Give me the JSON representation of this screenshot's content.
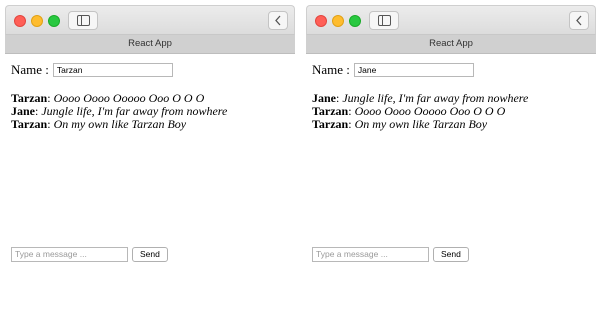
{
  "colors": {
    "close": "#ff5f57",
    "minimize": "#febc2e",
    "zoom": "#28c840",
    "tab_bar": "#d0d0d0"
  },
  "icons": {
    "sidebar": "sidebar-icon",
    "back": "chevron-left-icon"
  },
  "windows": [
    {
      "tab_title": "React App",
      "name_label": "Name :",
      "name_value": "Tarzan",
      "messages": [
        {
          "author": "Tarzan",
          "text": "Oooo Oooo Ooooo Ooo O O O"
        },
        {
          "author": "Jane",
          "text": "Jungle life, I'm far away from nowhere"
        },
        {
          "author": "Tarzan",
          "text": "On my own like Tarzan Boy"
        }
      ],
      "message_placeholder": "Type a message ...",
      "send_label": "Send"
    },
    {
      "tab_title": "React App",
      "name_label": "Name :",
      "name_value": "Jane",
      "messages": [
        {
          "author": "Jane",
          "text": "Jungle life, I'm far away from nowhere"
        },
        {
          "author": "Tarzan",
          "text": "Oooo Oooo Ooooo Ooo O O O"
        },
        {
          "author": "Tarzan",
          "text": "On my own like Tarzan Boy"
        }
      ],
      "message_placeholder": "Type a message ...",
      "send_label": "Send"
    }
  ]
}
